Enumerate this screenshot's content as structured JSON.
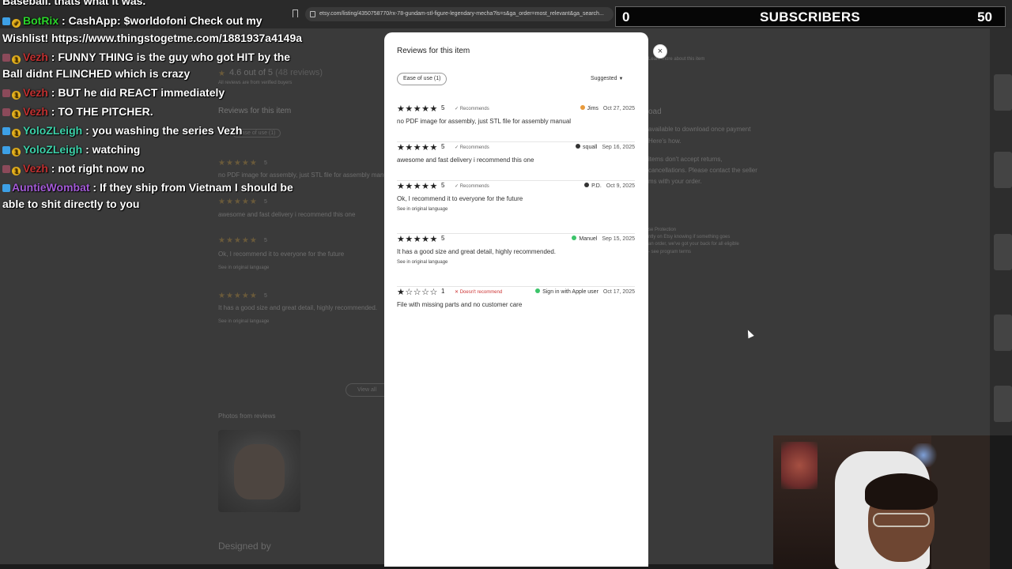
{
  "browser": {
    "url": "etsy.com/listing/4350758770/rx-78-gundam-stl-figure-legendary-mecha?ls=s&ga_order=most_relevant&ga_search..."
  },
  "background_page": {
    "rating": "4.6 out of 5",
    "review_count": "(48 reviews)",
    "verified_note": "All reviews are from verified buyers",
    "section_title": "Reviews for this item",
    "filter": "Ease of use (1)",
    "items": [
      {
        "rating": "5",
        "text": "no PDF image for assembly, just STL file for assembly manual"
      },
      {
        "rating": "5",
        "text": "awesome and fast delivery i recommend this one"
      },
      {
        "rating": "5",
        "text": "Ok, I recommend it to everyone for the future",
        "orig": "See in original language"
      },
      {
        "rating": "5",
        "text": "It has a good size and great detail, highly recommended.",
        "orig": "See in original language"
      }
    ],
    "view_all": "View all",
    "photos_title": "Photos from reviews",
    "designed_by": "Designed by",
    "right_panel": {
      "learn_more": "Learn more about this item",
      "download_text": "available to download once payment",
      "heres_how": "Here's how.",
      "returns_text": "items don't accept returns,",
      "cancellations_text": "cancellations. Please contact the seller",
      "order_text": "ms with your order.",
      "protection_title": "se Protection",
      "protection_text": "ntly on Etsy knowing if something goes",
      "protection_text2": "an order, we've got your back for all eligible",
      "program_terms": "- see program terms",
      "download_label": "oad"
    }
  },
  "chat": [
    {
      "user": "",
      "message": "Baseball. thats what it was."
    },
    {
      "user": "BotRix",
      "message": ": CashApp: $worldofoni Check out my",
      "cont": "Wishlist! https://www.thingstogetme.com/1881937a4149a",
      "class": "user-botrix"
    },
    {
      "user": "Vezh",
      "message": ": FUNNY THING is the guy who got HIT by the",
      "cont": "Ball didnt FLINCHED which is crazy",
      "class": "user-vezh"
    },
    {
      "user": "Vezh",
      "message": ": BUT he did REACT immediately",
      "class": "user-vezh"
    },
    {
      "user": "Vezh",
      "message": ": TO THE PITCHER.",
      "class": "user-vezh"
    },
    {
      "user": "YoloZLeigh",
      "message": ": you washing the series Vezh",
      "class": "user-yolo"
    },
    {
      "user": "YoloZLeigh",
      "message": ": watching",
      "class": "user-yolo"
    },
    {
      "user": "Vezh",
      "message": ": not right now no",
      "class": "user-vezh"
    },
    {
      "user": "AuntieWombat",
      "message": ": If they ship from Vietnam I should be",
      "cont": "able to shit directly to you",
      "class": "user-auntie"
    }
  ],
  "sub_counter": {
    "left": "0",
    "label": "SUBSCRIBERS",
    "right": "50"
  },
  "modal": {
    "title": "Reviews for this item",
    "close_label": "×",
    "filter_chip": "Ease of use (1)",
    "sort_label": "Suggested",
    "reviews": [
      {
        "stars": "★★★★★",
        "rating": "5",
        "rec": "✓ Recommends",
        "user": "Jims",
        "date": "Oct 27, 2025",
        "text": "no PDF image for assembly, just STL file for assembly manual",
        "orig": "",
        "avatar_color": "#e89a3c",
        "negative": false
      },
      {
        "stars": "★★★★★",
        "rating": "5",
        "rec": "✓ Recommends",
        "user": "squall",
        "date": "Sep 16, 2025",
        "text": "awesome and fast delivery i recommend this one",
        "orig": "",
        "avatar_color": "#333333",
        "negative": false
      },
      {
        "stars": "★★★★★",
        "rating": "5",
        "rec": "✓ Recommends",
        "user": "P.D.",
        "date": "Oct 9, 2025",
        "text": "Ok, I recommend it to everyone for the future",
        "orig": "See in original language",
        "avatar_color": "#333333",
        "negative": false
      },
      {
        "stars": "★★★★★",
        "rating": "5",
        "rec": "",
        "user": "Manuel",
        "date": "Sep 15, 2025",
        "text": "It has a good size and great detail, highly recommended.",
        "orig": "See in original language",
        "avatar_color": "#3cc46a",
        "negative": false
      },
      {
        "stars": "★☆☆☆☆",
        "rating": "1",
        "rec": "✕ Doesn't recommend",
        "user": "Sign in with Apple user",
        "date": "Oct 17, 2025",
        "text": "File with missing parts and no customer care",
        "orig": "",
        "avatar_color": "#3cc46a",
        "negative": true
      }
    ]
  }
}
